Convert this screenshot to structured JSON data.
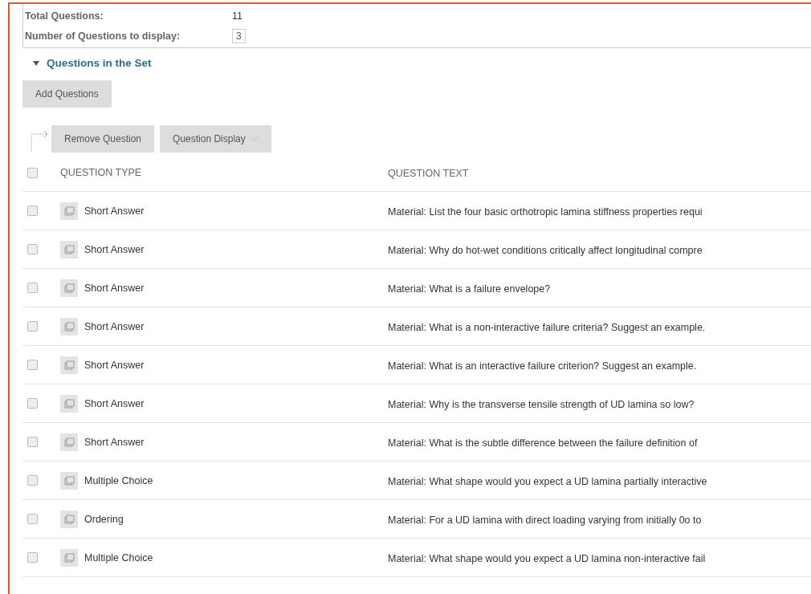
{
  "summary": {
    "total_label": "Total Questions:",
    "total_value": "11",
    "display_label": "Number of Questions to display:",
    "display_value": "3"
  },
  "section": {
    "title": "Questions in the Set",
    "expanded": true
  },
  "add_button": "Add Questions",
  "actions": [
    "Remove Question",
    "Question Display"
  ],
  "table": {
    "select_all_checked": false,
    "columns": [
      "QUESTION TYPE",
      "QUESTION TEXT"
    ],
    "rows": [
      {
        "checked": false,
        "type": "Short Answer",
        "text": "Material: List the four basic orthotropic lamina stiffness properties requi"
      },
      {
        "checked": false,
        "type": "Short Answer",
        "text": "Material: Why do hot-wet conditions critically affect longitudinal compre"
      },
      {
        "checked": false,
        "type": "Short Answer",
        "text": "Material: What is a failure envelope?"
      },
      {
        "checked": false,
        "type": "Short Answer",
        "text": "Material: What is a non-interactive failure criteria? Suggest an example."
      },
      {
        "checked": false,
        "type": "Short Answer",
        "text": "Material: What is an interactive failure criterion? Suggest an example."
      },
      {
        "checked": false,
        "type": "Short Answer",
        "text": "Material: Why is the transverse tensile strength of UD lamina so low?"
      },
      {
        "checked": false,
        "type": "Short Answer",
        "text": "Material: What is the subtle difference between the failure definition of"
      },
      {
        "checked": false,
        "type": "Multiple Choice",
        "text": "Material: What shape would you expect a UD lamina partially interactive"
      },
      {
        "checked": false,
        "type": "Ordering",
        "text": "Material: For a UD lamina with direct loading varying from initially 0o to"
      },
      {
        "checked": false,
        "type": "Multiple Choice",
        "text": "Material: What shape would you expect a UD lamina non-interactive fail"
      }
    ]
  }
}
